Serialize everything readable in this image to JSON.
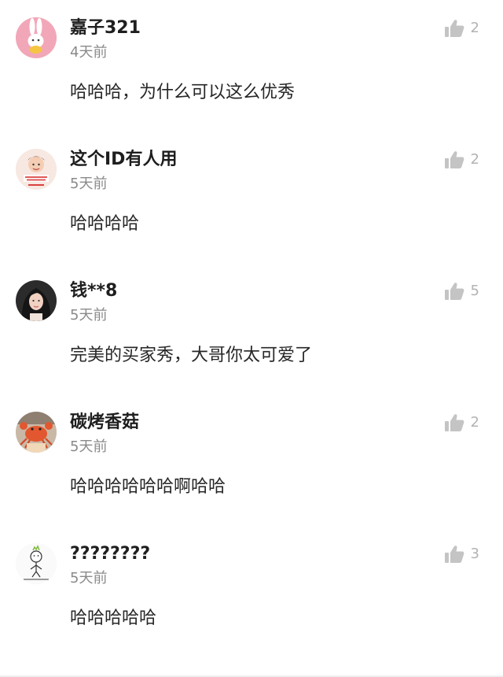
{
  "colors": {
    "background": "#ffffff",
    "username": "#1e1e1e",
    "timestamp": "#8a8a8a",
    "content": "#262626",
    "like": "#b3b3b3"
  },
  "comments": [
    {
      "avatar": "pink-bunny-avatar",
      "username": "嘉子321",
      "time": "4天前",
      "content": "哈哈哈，为什么可以这么优秀",
      "likes": "2",
      "like_icon": "thumbs-up-icon"
    },
    {
      "avatar": "baby-photo-avatar",
      "username": "这个ID有人用",
      "time": "5天前",
      "content": "哈哈哈哈",
      "likes": "2",
      "like_icon": "thumbs-up-icon"
    },
    {
      "avatar": "woman-portrait-avatar",
      "username": "钱**8",
      "time": "5天前",
      "content": "完美的买家秀，大哥你太可爱了",
      "likes": "5",
      "like_icon": "thumbs-up-icon"
    },
    {
      "avatar": "crab-photo-avatar",
      "username": "碳烤香菇",
      "time": "5天前",
      "content": "哈哈哈哈哈哈啊哈哈",
      "likes": "2",
      "like_icon": "thumbs-up-icon"
    },
    {
      "avatar": "doodle-figure-avatar",
      "username": "????????",
      "time": "5天前",
      "content": "哈哈哈哈哈",
      "likes": "3",
      "like_icon": "thumbs-up-icon"
    }
  ]
}
